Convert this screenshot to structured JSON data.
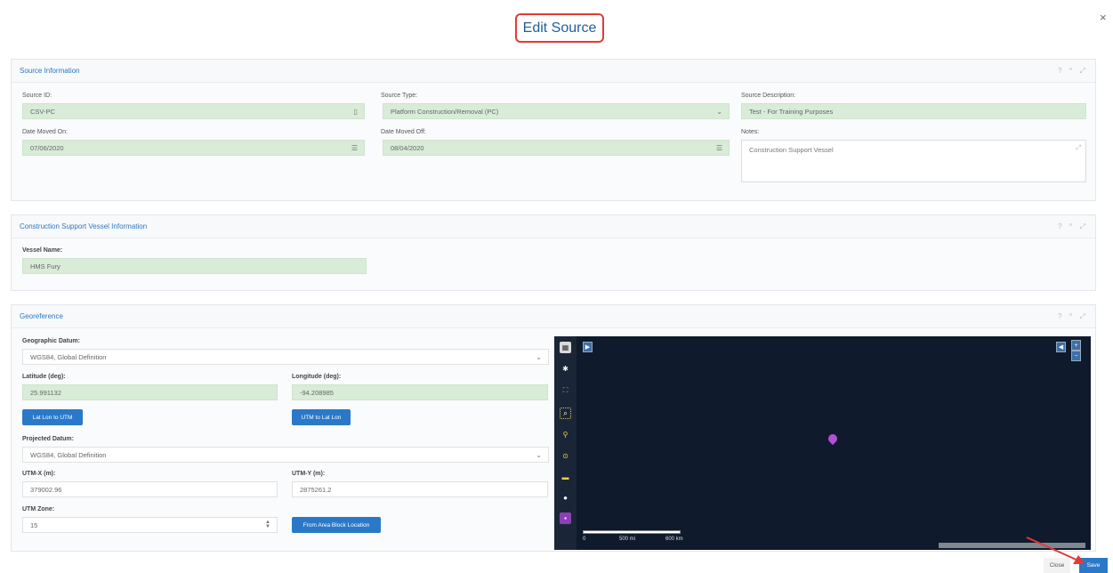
{
  "dialog": {
    "title": "Edit Source",
    "close_icon": "×"
  },
  "source_info": {
    "header": "Source Information",
    "tools": "? ^ ⤢",
    "source_id": {
      "label": "Source ID:",
      "value": "CSV-PC"
    },
    "source_type": {
      "label": "Source Type:",
      "value": "Platform Construction/Removal (PC)"
    },
    "source_description": {
      "label": "Source Description:",
      "value": "Test - For Training Purposes"
    },
    "date_moved_on": {
      "label": "Date Moved On:",
      "value": "07/06/2020"
    },
    "date_moved_off": {
      "label": "Date Moved Off:",
      "value": "08/04/2020"
    },
    "notes": {
      "label": "Notes:",
      "value": "Construction Support Vessel"
    }
  },
  "vessel_info": {
    "header": "Construction Support Vessel Information",
    "tools": "? ^ ⤢",
    "vessel_name": {
      "label": "Vessel Name:",
      "value": "HMS Fury"
    }
  },
  "georeference": {
    "header": "Georeference",
    "tools": "? ^ ⤢",
    "geographic_datum": {
      "label": "Geographic Datum:",
      "value": "WGS84, Global Definition"
    },
    "latitude": {
      "label": "Latitude (deg):",
      "value": "25.991132"
    },
    "longitude": {
      "label": "Longitude (deg):",
      "value": "-94.208985"
    },
    "latlon_to_utm": "Lat Lon to UTM",
    "utm_to_latlon": "UTM to Lat Lon",
    "projected_datum": {
      "label": "Projected Datum:",
      "value": "WGS84, Global Definition"
    },
    "utm_x": {
      "label": "UTM-X (m):",
      "value": "379002.96"
    },
    "utm_y": {
      "label": "UTM-Y (m):",
      "value": "2875261.2"
    },
    "utm_zone": {
      "label": "UTM Zone:",
      "value": "15"
    },
    "from_area_block": "From Area Block Location",
    "map": {
      "scale_labels": [
        "0",
        "500 mi",
        "600 km"
      ],
      "marker_color": "#b44fd6"
    }
  },
  "footer": {
    "close": "Close",
    "save": "Save"
  },
  "colors": {
    "accent": "#2a79c9",
    "green_field": "#d8ecd7",
    "map_bg": "#0f1b2c",
    "title_border": "#e53935"
  }
}
